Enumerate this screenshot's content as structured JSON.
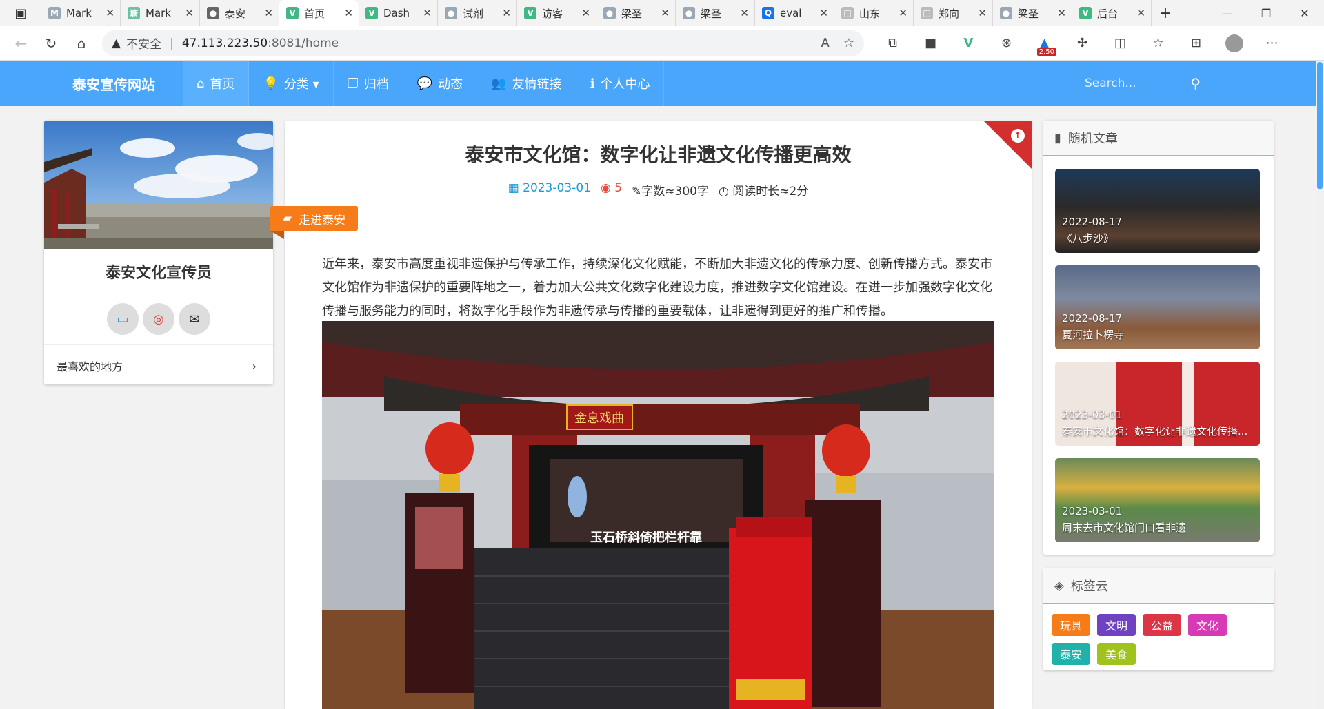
{
  "browser": {
    "tabs": [
      {
        "title": "Mark",
        "color": "#9aa7b5",
        "glyph": "M"
      },
      {
        "title": "Mark",
        "color": "#6cc0a0",
        "glyph": "塘"
      },
      {
        "title": "泰安",
        "color": "#666",
        "glyph": "●"
      },
      {
        "title": "首页",
        "color": "#41b883",
        "glyph": "V",
        "active": true
      },
      {
        "title": "Dash",
        "color": "#41b883",
        "glyph": "V"
      },
      {
        "title": "试剂",
        "color": "#9aa7b5",
        "glyph": "●"
      },
      {
        "title": "访客",
        "color": "#41b883",
        "glyph": "V"
      },
      {
        "title": "梁圣",
        "color": "#9aa7b5",
        "glyph": "●"
      },
      {
        "title": "梁圣",
        "color": "#9aa7b5",
        "glyph": "●"
      },
      {
        "title": "eval",
        "color": "#1a73e8",
        "glyph": "Q"
      },
      {
        "title": "山东",
        "color": "#bbb",
        "glyph": "□"
      },
      {
        "title": "郑向",
        "color": "#bbb",
        "glyph": "□"
      },
      {
        "title": "梁圣",
        "color": "#9aa7b5",
        "glyph": "●"
      },
      {
        "title": "后台",
        "color": "#41b883",
        "glyph": "V"
      }
    ],
    "security": "不安全",
    "host": "47.113.223.50",
    "rest": ":8081/home",
    "ext_badge": "2.50"
  },
  "site": {
    "brand": "泰安宣传网站",
    "nav": [
      {
        "icon": "⌂",
        "label": "首页",
        "active": true
      },
      {
        "icon": "💡",
        "label": "分类 ▾"
      },
      {
        "icon": "❐",
        "label": "归档"
      },
      {
        "icon": "💬",
        "label": "动态"
      },
      {
        "icon": "👥",
        "label": "友情链接"
      },
      {
        "icon": "ℹ",
        "label": "个人中心"
      }
    ],
    "search_placeholder": "Search..."
  },
  "profile": {
    "name": "泰安文化宣传员",
    "favorite_link": "最喜欢的地方"
  },
  "article": {
    "title": "泰安市文化馆：数字化让非遗文化传播更高效",
    "date": "2023-03-01",
    "views": "5",
    "words": "字数≈300字",
    "read_time": "阅读时长≈2分",
    "category": "走进泰安",
    "body": "近年来，泰安市高度重视非遗保护与传承工作，持续深化文化赋能，不断加大非遗文化的传承力度、创新传播方式。泰安市文化馆作为非遗保护的重要阵地之一，着力加大公共文化数字化建设力度，推进数字文化馆建设。在进一步加强数字化文化传播与服务能力的同时，将数字化手段作为非遗传承与传播的重要载体，让非遗得到更好的推广和传播。",
    "image_sign": "金息戏曲",
    "image_caption": "玉石桥斜倚把栏杆靠"
  },
  "random": {
    "heading": "随机文章",
    "items": [
      {
        "date": "2022-08-17",
        "title": "《八步沙》"
      },
      {
        "date": "2022-08-17",
        "title": "夏河拉卜楞寺"
      },
      {
        "date": "2023-03-01",
        "title": "泰安市文化馆：数字化让非遗文化传播..."
      },
      {
        "date": "2023-03-01",
        "title": "周末去市文化馆门口看非遗"
      }
    ]
  },
  "tagcloud": {
    "heading": "标签云",
    "tags": [
      {
        "label": "玩具",
        "color": "#f57c18"
      },
      {
        "label": "文明",
        "color": "#6f42c1"
      },
      {
        "label": "公益",
        "color": "#dc3545"
      },
      {
        "label": "文化",
        "color": "#d63ab5"
      },
      {
        "label": "泰安",
        "color": "#20b2aa"
      },
      {
        "label": "美食",
        "color": "#a0c21c"
      }
    ]
  }
}
